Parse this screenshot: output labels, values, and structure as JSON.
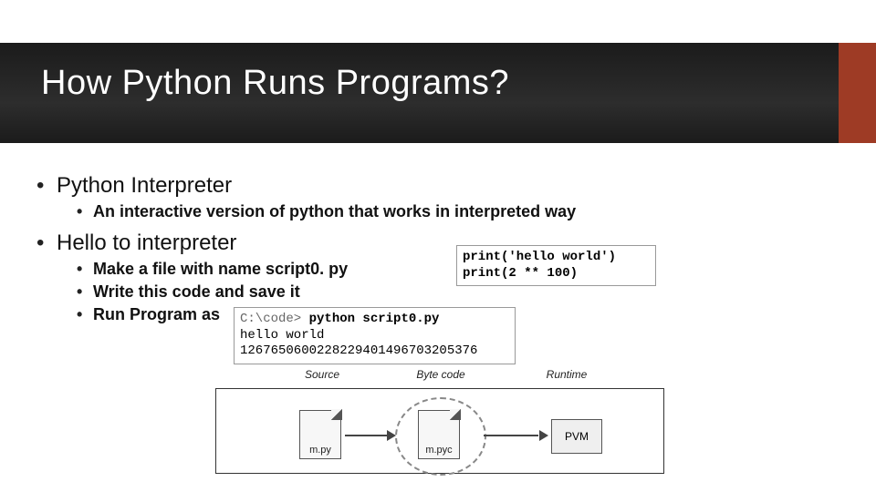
{
  "title": "How Python Runs Programs?",
  "bullets": {
    "b1": "Python Interpreter",
    "b1a": "An interactive version of python that works in interpreted way",
    "b2": "Hello to interpreter",
    "b2a": "Make a file with name script0. py",
    "b2b": "Write this code and save it",
    "b2c": "Run Program as"
  },
  "code1": {
    "line1": "print('hello world')",
    "line2": "print(2 ** 100)"
  },
  "code2": {
    "prompt": "C:\\code> ",
    "cmd": "python script0.py",
    "out1": "hello world",
    "out2": "1267650600228229401496703205376"
  },
  "diagram": {
    "col1": "Source",
    "col2": "Byte code",
    "col3": "Runtime",
    "file1": "m.py",
    "file2": "m.pyc",
    "pvm": "PVM"
  }
}
